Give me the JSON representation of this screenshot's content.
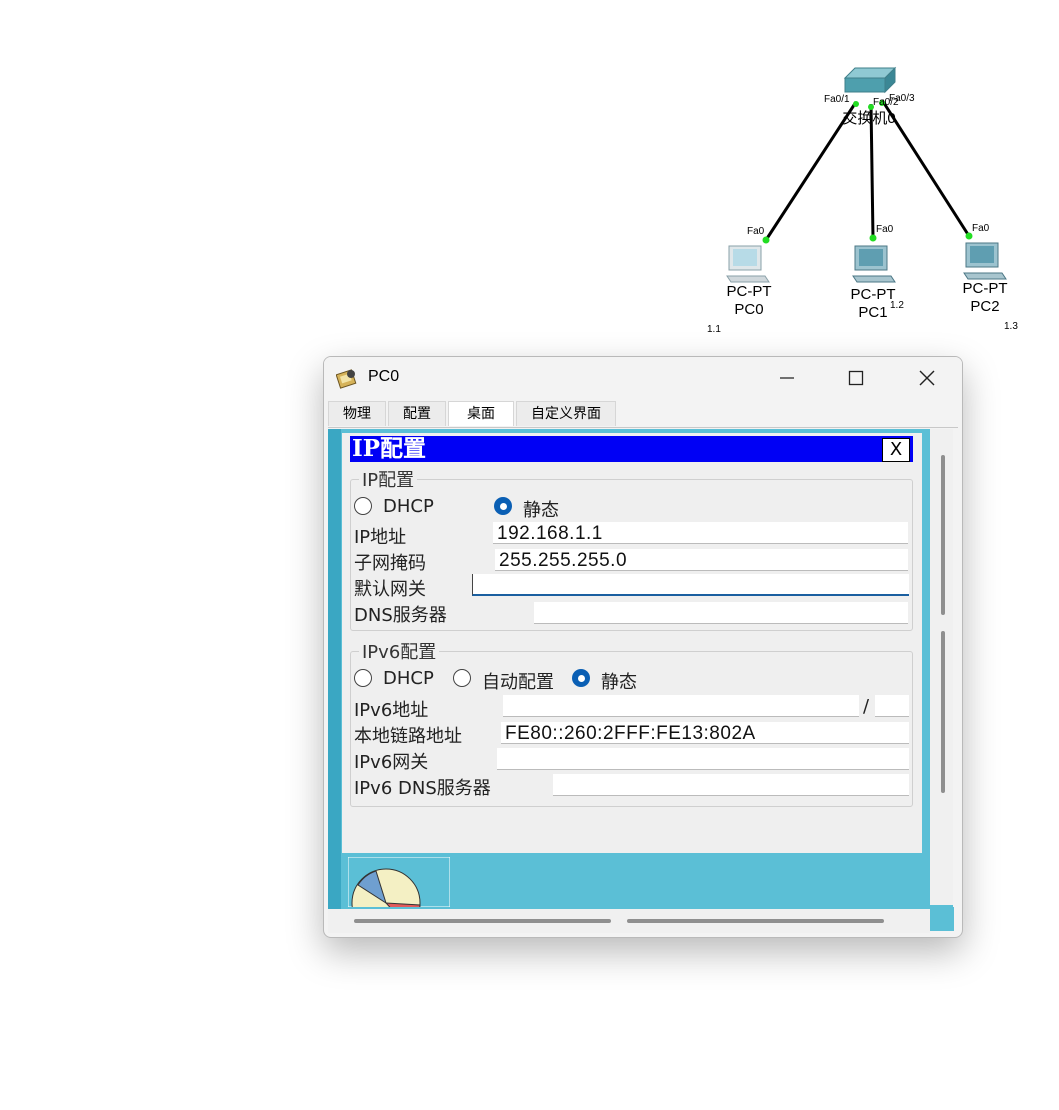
{
  "topology": {
    "switch": {
      "name": "交换机0",
      "ports": [
        "Fa0/1",
        "Fa0/2",
        "Fa0/3"
      ]
    },
    "pcs": [
      {
        "type": "PC-PT",
        "name": "PC0",
        "port": "Fa0",
        "address": "1.1"
      },
      {
        "type": "PC-PT",
        "name": "PC1",
        "port": "Fa0",
        "address": "1.2"
      },
      {
        "type": "PC-PT",
        "name": "PC2",
        "port": "Fa0",
        "address": "1.3"
      }
    ],
    "link_color": "#000000",
    "port_dot_color": "#22dd22"
  },
  "window": {
    "title": "PC0",
    "icon": "pc-config-icon",
    "tabs": [
      {
        "label": "物理",
        "active": false
      },
      {
        "label": "配置",
        "active": false
      },
      {
        "label": "桌面",
        "active": true
      },
      {
        "label": "自定义界面",
        "active": false
      }
    ]
  },
  "ip_dialog": {
    "title": "IP配置",
    "close_label": "X",
    "ipv4": {
      "group_title": "IP配置",
      "dhcp_label": "DHCP",
      "static_label": "静态",
      "mode": "static",
      "ip_label": "IP地址",
      "ip_value": "192.168.1.1",
      "mask_label": "子网掩码",
      "mask_value": "255.255.255.0",
      "gateway_label": "默认网关",
      "gateway_value": "",
      "dns_label": "DNS服务器",
      "dns_value": ""
    },
    "ipv6": {
      "group_title": "IPv6配置",
      "dhcp_label": "DHCP",
      "auto_label": "自动配置",
      "static_label": "静态",
      "mode": "static",
      "addr_label": "IPv6地址",
      "addr_value": "",
      "prefix_sep": "/",
      "prefix_value": "",
      "link_local_label": "本地链路地址",
      "link_local_value": "FE80::260:2FFF:FE13:802A",
      "gateway_label": "IPv6网关",
      "gateway_value": "",
      "dns_label": "IPv6 DNS服务器",
      "dns_value": ""
    }
  },
  "colors": {
    "desktop_bg": "#5bbfd6",
    "dialog_title_bg": "#0000f5",
    "radio_on": "#0a5fb4"
  }
}
